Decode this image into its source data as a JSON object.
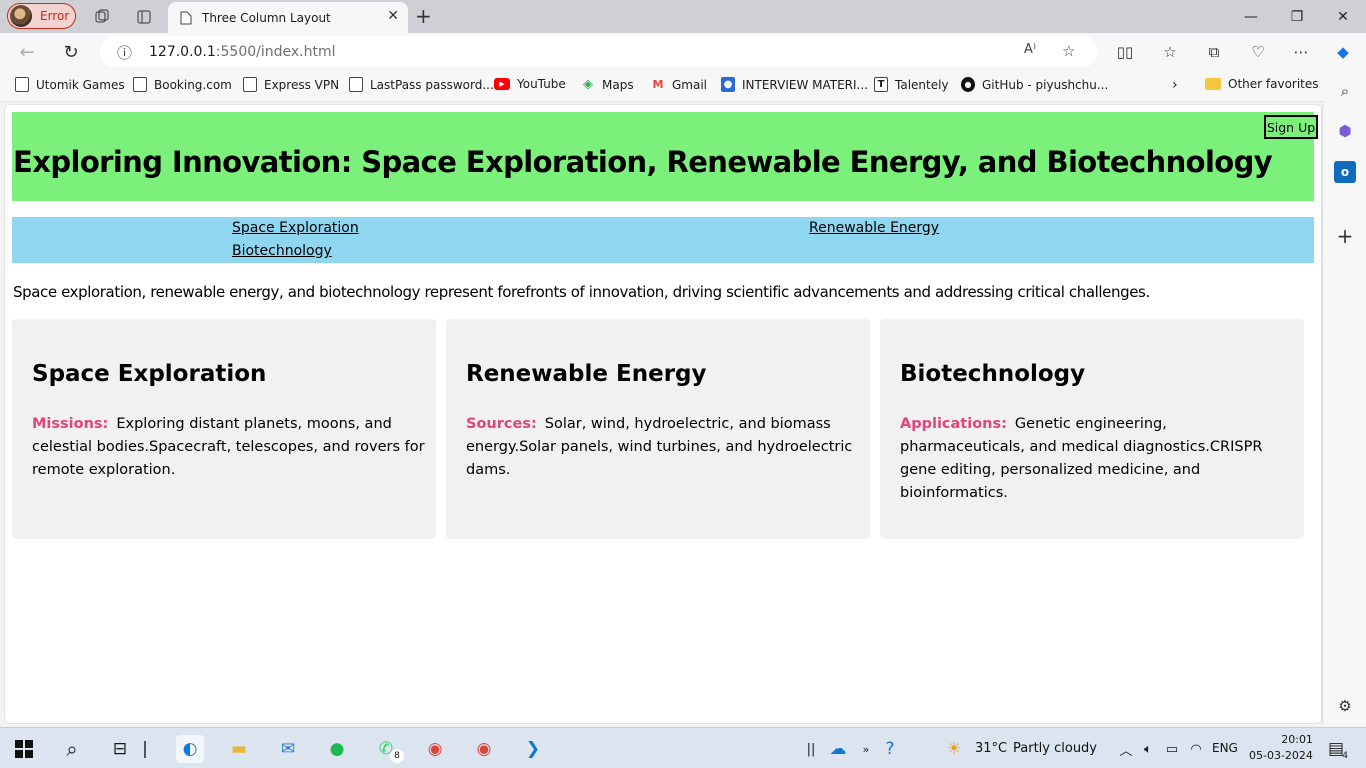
{
  "browser": {
    "profile_label": "Error",
    "tab_title": "Three Column Layout",
    "url_host": "127.0.0.1",
    "url_rest": ":5500/index.html",
    "bookmarks": [
      {
        "label": "Utomik Games",
        "icon": "page-icon"
      },
      {
        "label": "Booking.com",
        "icon": "page-icon"
      },
      {
        "label": "Express VPN",
        "icon": "page-icon"
      },
      {
        "label": "LastPass password...",
        "icon": "page-icon"
      },
      {
        "label": "YouTube",
        "icon": "youtube-icon"
      },
      {
        "label": "Maps",
        "icon": "maps-icon"
      },
      {
        "label": "Gmail",
        "icon": "gmail-icon"
      },
      {
        "label": "INTERVIEW MATERI...",
        "icon": "contact-icon"
      },
      {
        "label": "Talentely",
        "icon": "talentely-icon"
      },
      {
        "label": "GitHub - piyushchu...",
        "icon": "github-icon"
      }
    ],
    "other_favorites": "Other favorites"
  },
  "page": {
    "title": "Exploring Innovation: Space Exploration, Renewable Energy, and Biotechnology",
    "signup_label": "Sign Up",
    "nav": [
      "Space Exploration",
      "Renewable Energy",
      "Biotechnology"
    ],
    "intro": "Space exploration, renewable energy, and biotechnology represent forefronts of innovation, driving scientific advancements and addressing critical challenges.",
    "cards": [
      {
        "heading": "Space Exploration",
        "label": "Missions:",
        "text": "Exploring distant planets, moons, and celestial bodies.Spacecraft, telescopes, and rovers for remote exploration."
      },
      {
        "heading": "Renewable Energy",
        "label": "Sources:",
        "text": "Solar, wind, hydroelectric, and biomass energy.Solar panels, wind turbines, and hydroelectric dams."
      },
      {
        "heading": "Biotechnology",
        "label": "Applications:",
        "text": "Genetic engineering, pharmaceuticals, and medical diagnostics.CRISPR gene editing, personalized medicine, and bioinformatics."
      }
    ]
  },
  "taskbar": {
    "weather_temp": "31°C",
    "weather_text": "Partly cloudy",
    "language": "ENG",
    "time": "20:01",
    "date": "05-03-2024",
    "whatsapp_badge": "8",
    "notification_count": "4"
  },
  "colors": {
    "header_bg": "#7bf17b",
    "nav_bg": "#8fd6f0",
    "card_bg": "#f1f1f1",
    "label_accent": "#e0457b"
  }
}
